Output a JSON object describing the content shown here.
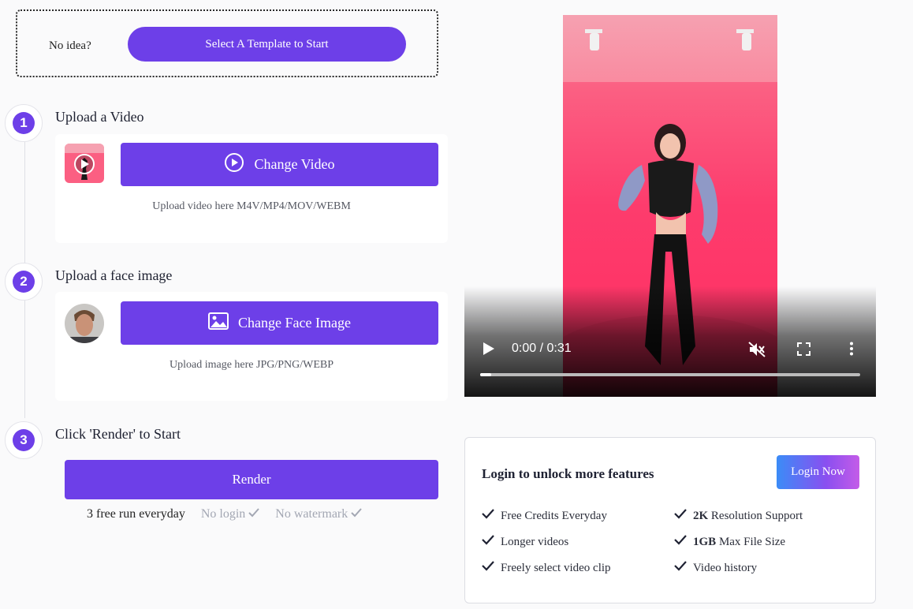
{
  "template": {
    "prompt": "No idea?",
    "button": "Select A Template to Start"
  },
  "steps": [
    {
      "number": "1",
      "title": "Upload a Video",
      "button": "Change Video",
      "hint": "Upload video here M4V/MP4/MOV/WEBM"
    },
    {
      "number": "2",
      "title": "Upload a face image",
      "button": "Change Face Image",
      "hint": "Upload image here JPG/PNG/WEBP"
    },
    {
      "number": "3",
      "title": "Click 'Render' to Start",
      "button": "Render"
    }
  ],
  "free": {
    "runs": "3 free run everyday",
    "no_login": "No login",
    "no_watermark": "No watermark"
  },
  "video": {
    "time": "0:00 / 0:31",
    "progress": 0.03,
    "muted": true
  },
  "login": {
    "title": "Login to unlock more features",
    "button": "Login Now",
    "features_left": [
      "Free Credits Everyday",
      "Longer videos",
      "Freely select video clip"
    ],
    "features_right": [
      {
        "bold": "2K",
        "text": " Resolution Support"
      },
      {
        "bold": "1GB",
        "text": " Max File Size"
      },
      {
        "bold": "",
        "text": "Video history"
      }
    ]
  },
  "colors": {
    "accent": "#6d3fe8",
    "login_gradient_start": "#3b8cf7",
    "login_gradient_end": "#c45ce8"
  }
}
